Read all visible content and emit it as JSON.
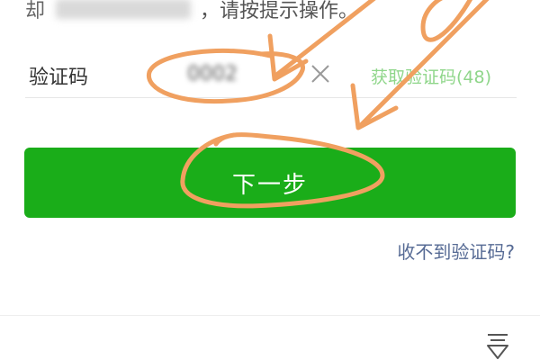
{
  "instruction": {
    "prefix": "却",
    "text": "，请按提示操作。"
  },
  "code_row": {
    "label": "验证码",
    "value": "0002",
    "placeholder": "",
    "resend_label": "获取验证码(48)"
  },
  "next_button": {
    "label": "下一步"
  },
  "help_link": {
    "label": "收不到验证码?"
  },
  "colors": {
    "primary_green": "#1aad19",
    "resend_green": "#8fd68a",
    "link_blue": "#576b95",
    "annotation_orange": "#f0a060"
  },
  "icons": {
    "clear": "close-icon",
    "bottom": "filter-icon"
  }
}
